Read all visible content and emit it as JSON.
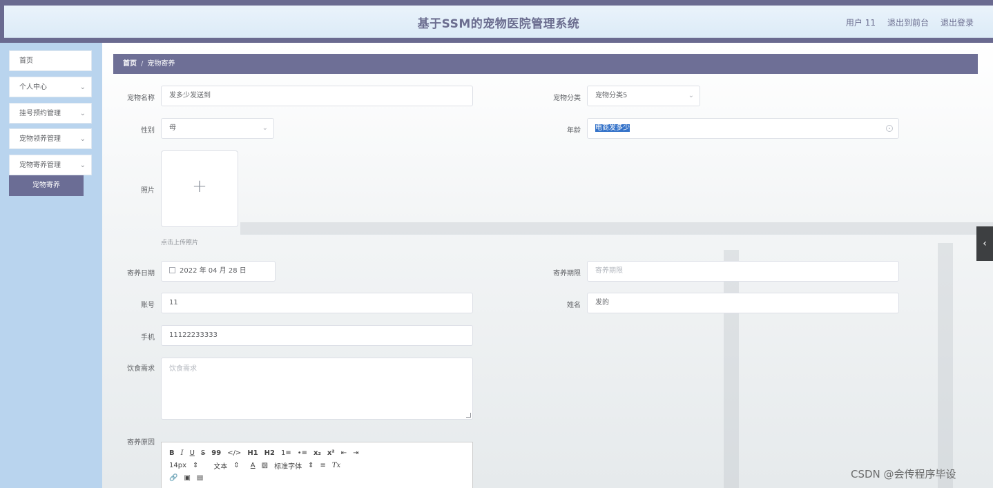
{
  "header": {
    "title": "基于SSM的宠物医院管理系统",
    "user": "用户 11",
    "to_front": "退出到前台",
    "logout": "退出登录"
  },
  "sidebar": {
    "items": [
      {
        "label": "首页"
      },
      {
        "label": "个人中心"
      },
      {
        "label": "挂号预约管理"
      },
      {
        "label": "宠物领养管理"
      },
      {
        "label": "宠物寄养管理"
      }
    ],
    "active_sub": "宠物寄养"
  },
  "breadcrumb": {
    "home": "首页",
    "sep": "/",
    "current": "宠物寄养"
  },
  "form": {
    "pet_name": {
      "label": "宠物名称",
      "value": "发多少发送到"
    },
    "category": {
      "label": "宠物分类",
      "value": "宠物分类5"
    },
    "gender": {
      "label": "性别",
      "value": "母"
    },
    "age": {
      "label": "年龄",
      "value": "电商发多少"
    },
    "photo": {
      "label": "照片",
      "plus": "+",
      "tip": "点击上传照片"
    },
    "date": {
      "label": "寄养日期",
      "value": "2022 年 04 月 28 日"
    },
    "period": {
      "label": "寄养期限",
      "placeholder": "寄养期限"
    },
    "account": {
      "label": "账号",
      "value": "11"
    },
    "name": {
      "label": "姓名",
      "value": "发的"
    },
    "phone": {
      "label": "手机",
      "value": "11122233333"
    },
    "diet": {
      "label": "饮食需求",
      "placeholder": "饮食需求"
    },
    "reason": {
      "label": "寄养原因"
    }
  },
  "editor": {
    "row1": [
      "B",
      "I",
      "U",
      "S",
      "99",
      "</>",
      "H1",
      "H2",
      "1≡",
      "•≡",
      "x₂",
      "x²",
      "⇤",
      "⇥"
    ],
    "font_size": "14px",
    "text_type": "文本",
    "font_family": "标准字体",
    "clear": "Tx"
  },
  "side_toggle": "‹",
  "watermark": "CSDN @会传程序毕设"
}
